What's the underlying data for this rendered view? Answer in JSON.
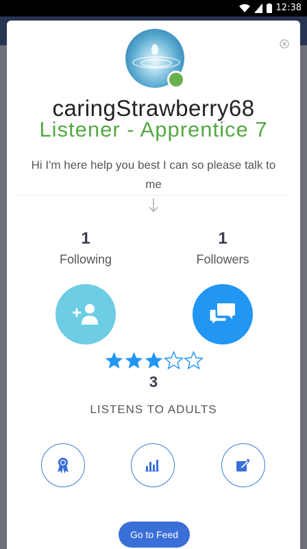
{
  "status_bar": {
    "time": "12:38"
  },
  "profile": {
    "username": "caringStrawberry68",
    "rank": "Listener - Apprentice 7",
    "bio": "Hi I'm here help you best I can so please talk to me"
  },
  "stats": {
    "following_count": "1",
    "following_label": "Following",
    "followers_count": "1",
    "followers_label": "Followers"
  },
  "rating": {
    "value": "3",
    "stars_filled": 3,
    "stars_total": 5
  },
  "listens_to": "LISTENS TO ADULTS",
  "buttons": {
    "go_to_feed": "Go to Feed"
  },
  "icons": [
    "close-icon",
    "arrow-down-icon",
    "add-user-icon",
    "chat-icon",
    "award-badge-icon",
    "bar-chart-icon",
    "edit-icon"
  ],
  "colors": {
    "rank_green": "#54a844",
    "follow_teal": "#6ccde4",
    "message_blue": "#2196f3",
    "accent_blue": "#3a6fd8",
    "online_green": "#6ab04c"
  }
}
